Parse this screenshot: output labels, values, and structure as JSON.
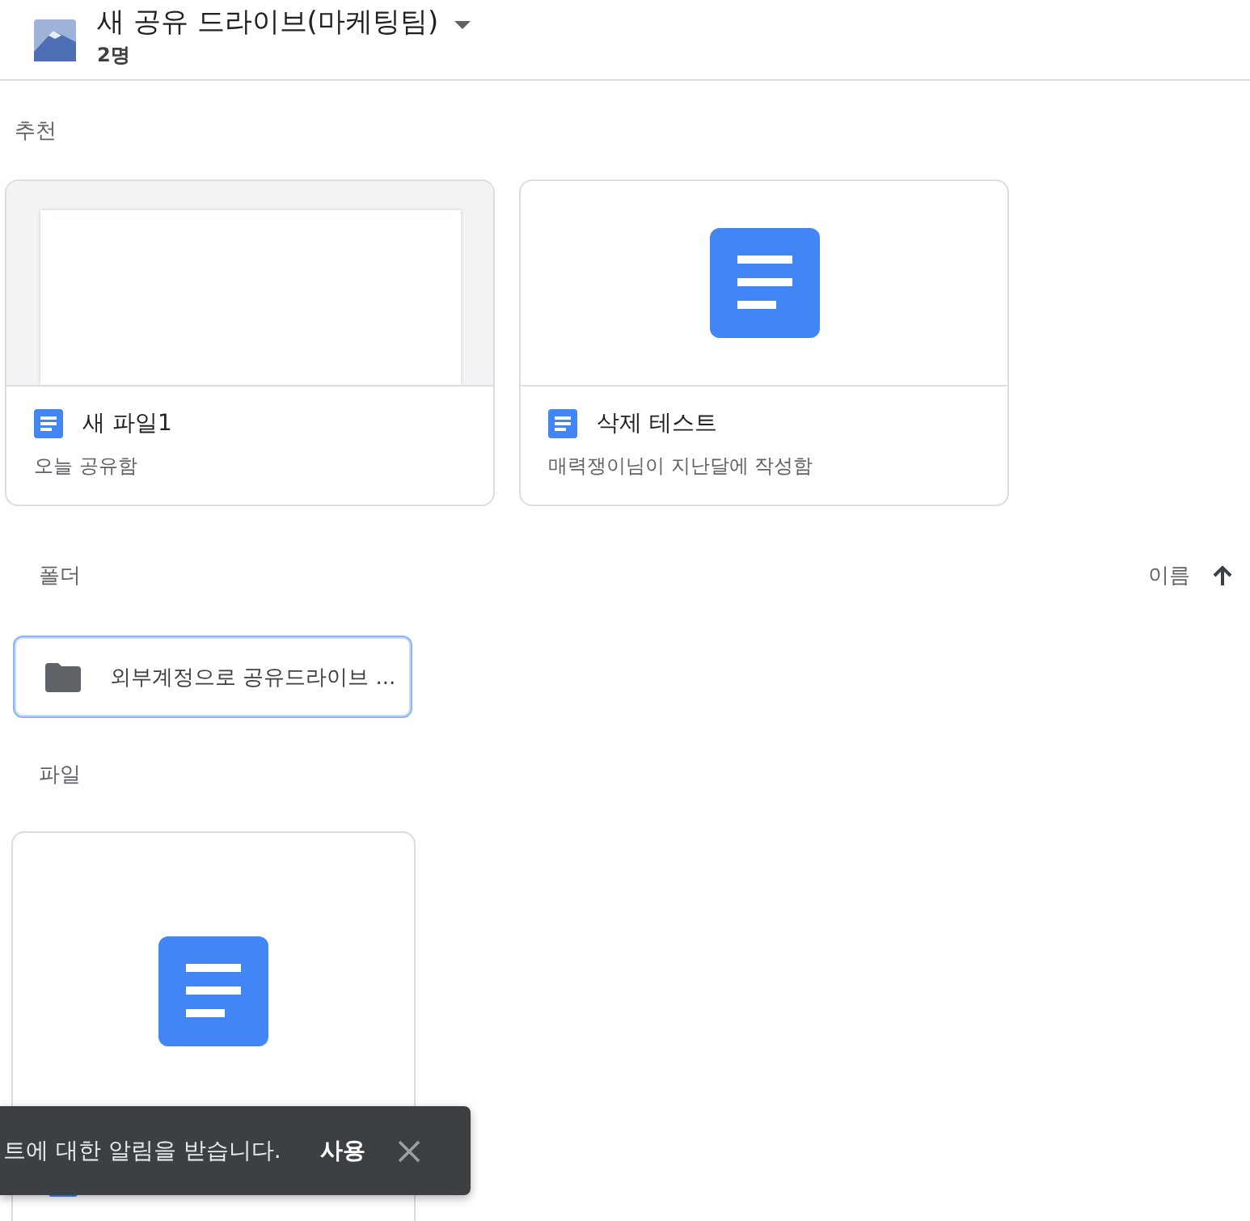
{
  "header": {
    "title": "새 공유 드라이브(마케팅팀)",
    "members": "2명"
  },
  "suggested": {
    "heading": "추천",
    "cards": [
      {
        "name": "새 파일1",
        "subtitle": "오늘 공유함",
        "kind": "blank"
      },
      {
        "name": "삭제 테스트",
        "subtitle": "매력쟁이님이 지난달에 작성함",
        "kind": "doc"
      }
    ]
  },
  "folders": {
    "heading": "폴더",
    "sort": {
      "label": "이름"
    },
    "items": [
      {
        "name": "외부계정으로 공유드라이브 ...",
        "selected": true
      }
    ]
  },
  "files": {
    "heading": "파일",
    "items": [
      {
        "kind": "doc"
      }
    ]
  },
  "snackbar": {
    "message": "트에 대한 알림을 받습니다.",
    "action": "사용"
  }
}
